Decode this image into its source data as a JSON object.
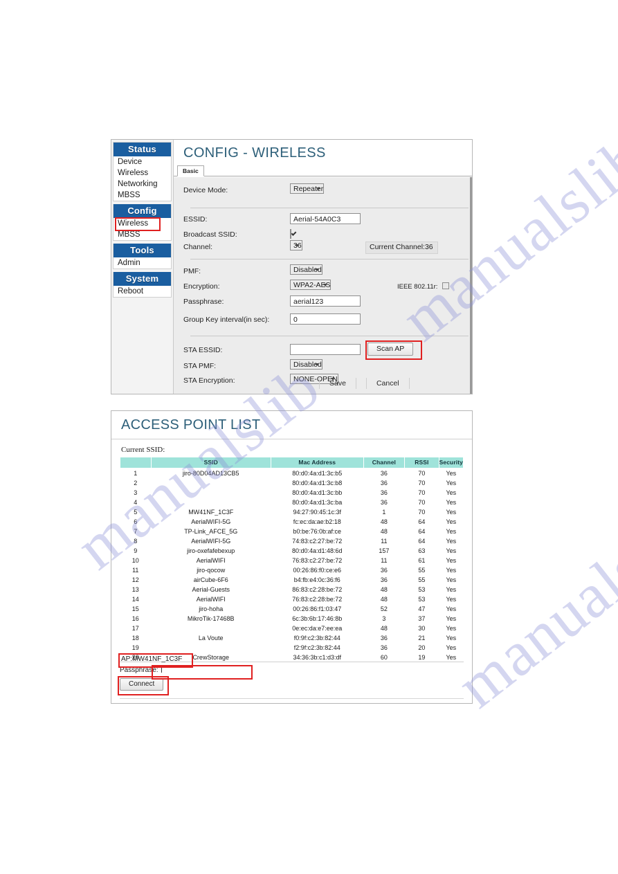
{
  "watermark": {
    "text": "manualslib"
  },
  "config_panel": {
    "title": "CONFIG - WIRELESS",
    "tab_label": "Basic",
    "sidebar": {
      "groups": [
        {
          "head": "Status",
          "items": [
            {
              "label": "Device",
              "highlighted": false
            },
            {
              "label": "Wireless",
              "highlighted": false
            },
            {
              "label": "Networking",
              "highlighted": false
            },
            {
              "label": "MBSS",
              "highlighted": false
            }
          ]
        },
        {
          "head": "Config",
          "items": [
            {
              "label": "Wireless",
              "highlighted": true
            },
            {
              "label": "MBSS",
              "highlighted": false
            }
          ]
        },
        {
          "head": "Tools",
          "items": [
            {
              "label": "Admin",
              "highlighted": false
            }
          ]
        },
        {
          "head": "System",
          "items": [
            {
              "label": "Reboot",
              "highlighted": false
            }
          ]
        }
      ]
    },
    "fields": {
      "device_mode_label": "Device Mode:",
      "device_mode_value": "Repeater",
      "essid_label": "ESSID:",
      "essid_value": "Aerial-54A0C3",
      "broadcast_ssid_label": "Broadcast SSID:",
      "channel_label": "Channel:",
      "channel_value": "36",
      "current_channel_text": "Current Channel:36",
      "pmf_label": "PMF:",
      "pmf_value": "Disabled",
      "encryption_label": "Encryption:",
      "encryption_value": "WPA2-AES",
      "ieee_label": "IEEE 802.11r:",
      "passphrase_label": "Passphrase:",
      "passphrase_value": "aerial123",
      "group_key_label": "Group Key interval(in sec):",
      "group_key_value": "0",
      "sta_essid_label": "STA ESSID:",
      "sta_essid_value": "",
      "scan_ap_label": "Scan AP",
      "sta_pmf_label": "STA PMF:",
      "sta_pmf_value": "Disabled",
      "sta_encryption_label": "STA Encryption:",
      "sta_encryption_value": "NONE-OPEN"
    },
    "buttons": {
      "save": "Save",
      "cancel": "Cancel"
    }
  },
  "ap_panel": {
    "title": "ACCESS POINT LIST",
    "current_ssid_label": "Current SSID:",
    "columns": [
      "",
      "SSID",
      "Mac Address",
      "Channel",
      "RSSI",
      "Security"
    ],
    "rows": [
      {
        "idx": "1",
        "ssid": "jiro-80D04AD13CB5",
        "mac": "80:d0:4a:d1:3c:b5",
        "channel": "36",
        "rssi": "70",
        "security": "Yes",
        "highlighted": false
      },
      {
        "idx": "2",
        "ssid": "",
        "mac": "80:d0:4a:d1:3c:b8",
        "channel": "36",
        "rssi": "70",
        "security": "Yes",
        "highlighted": false
      },
      {
        "idx": "3",
        "ssid": "",
        "mac": "80:d0:4a:d1:3c:bb",
        "channel": "36",
        "rssi": "70",
        "security": "Yes",
        "highlighted": false
      },
      {
        "idx": "4",
        "ssid": "",
        "mac": "80:d0:4a:d1:3c:ba",
        "channel": "36",
        "rssi": "70",
        "security": "Yes",
        "highlighted": false
      },
      {
        "idx": "5",
        "ssid": "MW41NF_1C3F",
        "mac": "94:27:90:45:1c:3f",
        "channel": "1",
        "rssi": "70",
        "security": "Yes",
        "highlighted": true
      },
      {
        "idx": "6",
        "ssid": "AerialWIFI-5G",
        "mac": "fc:ec:da:ae:b2:18",
        "channel": "48",
        "rssi": "64",
        "security": "Yes",
        "highlighted": false
      },
      {
        "idx": "7",
        "ssid": "TP-Link_AFCE_5G",
        "mac": "b0:be:76:0b:af:ce",
        "channel": "48",
        "rssi": "64",
        "security": "Yes",
        "highlighted": false
      },
      {
        "idx": "8",
        "ssid": "AerialWIFI-5G",
        "mac": "74:83:c2:27:be:72",
        "channel": "11",
        "rssi": "64",
        "security": "Yes",
        "highlighted": false
      },
      {
        "idx": "9",
        "ssid": "jiro-oxefafebexup",
        "mac": "80:d0:4a:d1:48:6d",
        "channel": "157",
        "rssi": "63",
        "security": "Yes",
        "highlighted": false
      },
      {
        "idx": "10",
        "ssid": "AerialWIFI",
        "mac": "76:83:c2:27:be:72",
        "channel": "11",
        "rssi": "61",
        "security": "Yes",
        "highlighted": false
      },
      {
        "idx": "11",
        "ssid": "jiro-qocow",
        "mac": "00:26:86:f0:ce:e6",
        "channel": "36",
        "rssi": "55",
        "security": "Yes",
        "highlighted": false
      },
      {
        "idx": "12",
        "ssid": "airCube-6F6",
        "mac": "b4:fb:e4:0c:36:f6",
        "channel": "36",
        "rssi": "55",
        "security": "Yes",
        "highlighted": false
      },
      {
        "idx": "13",
        "ssid": "Aerial-Guests",
        "mac": "86:83:c2:28:be:72",
        "channel": "48",
        "rssi": "53",
        "security": "Yes",
        "highlighted": false
      },
      {
        "idx": "14",
        "ssid": "AerialWIFI",
        "mac": "76:83:c2:28:be:72",
        "channel": "48",
        "rssi": "53",
        "security": "Yes",
        "highlighted": false
      },
      {
        "idx": "15",
        "ssid": "jiro-hoha",
        "mac": "00:26:86:f1:03:47",
        "channel": "52",
        "rssi": "47",
        "security": "Yes",
        "highlighted": false
      },
      {
        "idx": "16",
        "ssid": "MikroTik-17468B",
        "mac": "6c:3b:6b:17:46:8b",
        "channel": "3",
        "rssi": "37",
        "security": "Yes",
        "highlighted": false
      },
      {
        "idx": "17",
        "ssid": "",
        "mac": "0e:ec:da:e7:ee:ea",
        "channel": "48",
        "rssi": "30",
        "security": "Yes",
        "highlighted": false
      },
      {
        "idx": "18",
        "ssid": "La Voute",
        "mac": "f0:9f:c2:3b:82:44",
        "channel": "36",
        "rssi": "21",
        "security": "Yes",
        "highlighted": false
      },
      {
        "idx": "19",
        "ssid": "",
        "mac": "f2:9f:c2:3b:82:44",
        "channel": "36",
        "rssi": "20",
        "security": "Yes",
        "highlighted": false
      },
      {
        "idx": "20",
        "ssid": "CrewStorage",
        "mac": "34:36:3b:c1:d3:df",
        "channel": "60",
        "rssi": "19",
        "security": "Yes",
        "highlighted": false
      }
    ],
    "selected_ap_text": "AP:MW41NF_1C3F",
    "passphrase_label": "Passphrase:",
    "passphrase_value": "",
    "connect_label": "Connect"
  },
  "colors": {
    "menu_head_blue": "#1a5ea0",
    "title_blue": "#2d5f79",
    "table_header_teal": "#9fe3da",
    "highlight_red": "#e02020",
    "watermark_purple": "#8b8fd6"
  }
}
